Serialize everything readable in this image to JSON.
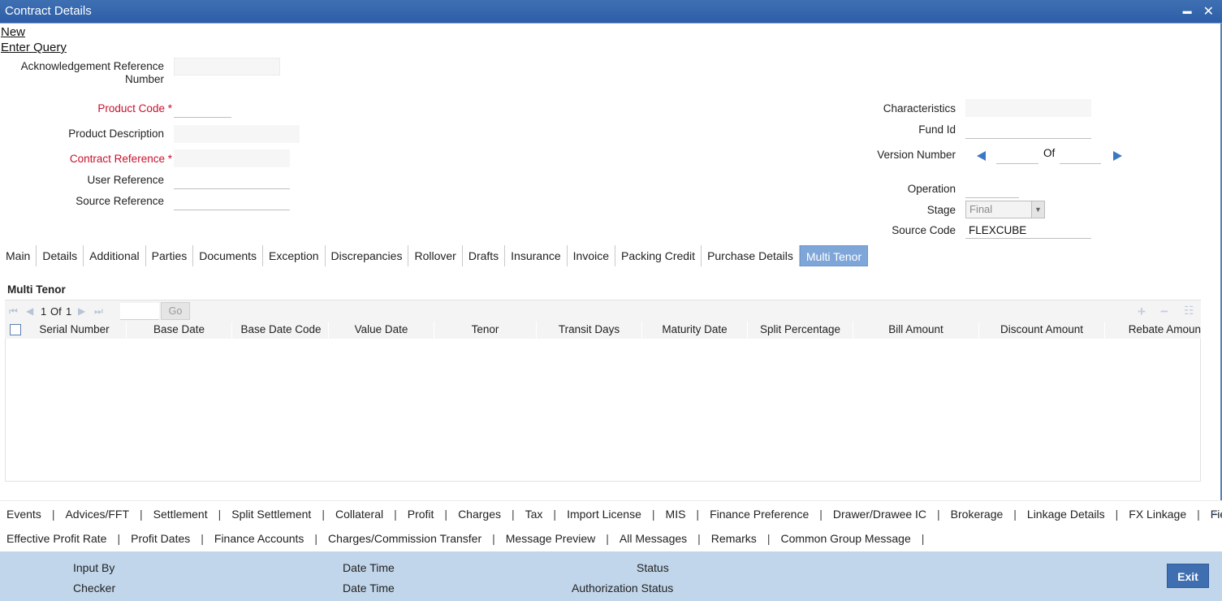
{
  "window": {
    "title": "Contract Details",
    "minimize_glyph": "▬",
    "close_glyph": "✕"
  },
  "actions": {
    "new": "New",
    "enter_query": "Enter Query"
  },
  "form": {
    "ack_ref_label_line1": "Acknowledgement Reference",
    "ack_ref_label_line2": "Number",
    "product_code_label": "Product Code",
    "product_description_label": "Product Description",
    "contract_reference_label": "Contract Reference",
    "user_reference_label": "User Reference",
    "source_reference_label": "Source Reference",
    "required_mark": "*",
    "characteristics_label": "Characteristics",
    "fund_id_label": "Fund Id",
    "version_number_label": "Version Number",
    "of_label": "Of",
    "operation_label": "Operation",
    "stage_label": "Stage",
    "stage_value": "Final",
    "source_code_label": "Source Code",
    "source_code_value": "FLEXCUBE"
  },
  "tabs": [
    {
      "label": "Main"
    },
    {
      "label": "Details"
    },
    {
      "label": "Additional"
    },
    {
      "label": "Parties"
    },
    {
      "label": "Documents"
    },
    {
      "label": "Exception"
    },
    {
      "label": "Discrepancies"
    },
    {
      "label": "Rollover"
    },
    {
      "label": "Drafts"
    },
    {
      "label": "Insurance"
    },
    {
      "label": "Invoice"
    },
    {
      "label": "Packing Credit"
    },
    {
      "label": "Purchase Details"
    },
    {
      "label": "Multi Tenor",
      "active": true
    }
  ],
  "multi_tenor": {
    "section_title": "Multi Tenor",
    "pager": {
      "current": "1",
      "of_text": "Of",
      "total": "1",
      "go_label": "Go"
    },
    "columns": [
      "Serial Number",
      "Base Date",
      "Base Date Code",
      "Value Date",
      "Tenor",
      "Transit Days",
      "Maturity Date",
      "Split Percentage",
      "Bill Amount",
      "Discount Amount",
      "Rebate Amoun"
    ]
  },
  "bottom_links_row1": [
    "Events",
    "Advices/FFT",
    "Settlement",
    "Split Settlement",
    "Collateral",
    "Profit",
    "Charges",
    "Tax",
    "Import License",
    "MIS",
    "Finance Preference",
    "Drawer/Drawee IC",
    "Brokerage",
    "Linkage Details",
    "FX Linkage",
    "Fields"
  ],
  "bottom_links_row2": [
    "Effective Profit Rate",
    "Profit Dates",
    "Finance Accounts",
    "Charges/Commission Transfer",
    "Message Preview",
    "All Messages",
    "Remarks",
    "Common Group Message"
  ],
  "footer": {
    "input_by": "Input By",
    "checker": "Checker",
    "date_time_1": "Date Time",
    "date_time_2": "Date Time",
    "status": "Status",
    "authorization_status": "Authorization Status",
    "exit_label": "Exit"
  },
  "colors": {
    "titlebar": "#2d5ea6",
    "required": "#c8102e",
    "active_tab": "#7fa6d8",
    "footer": "#c1d6ea",
    "exit_button": "#3f6fb0"
  }
}
